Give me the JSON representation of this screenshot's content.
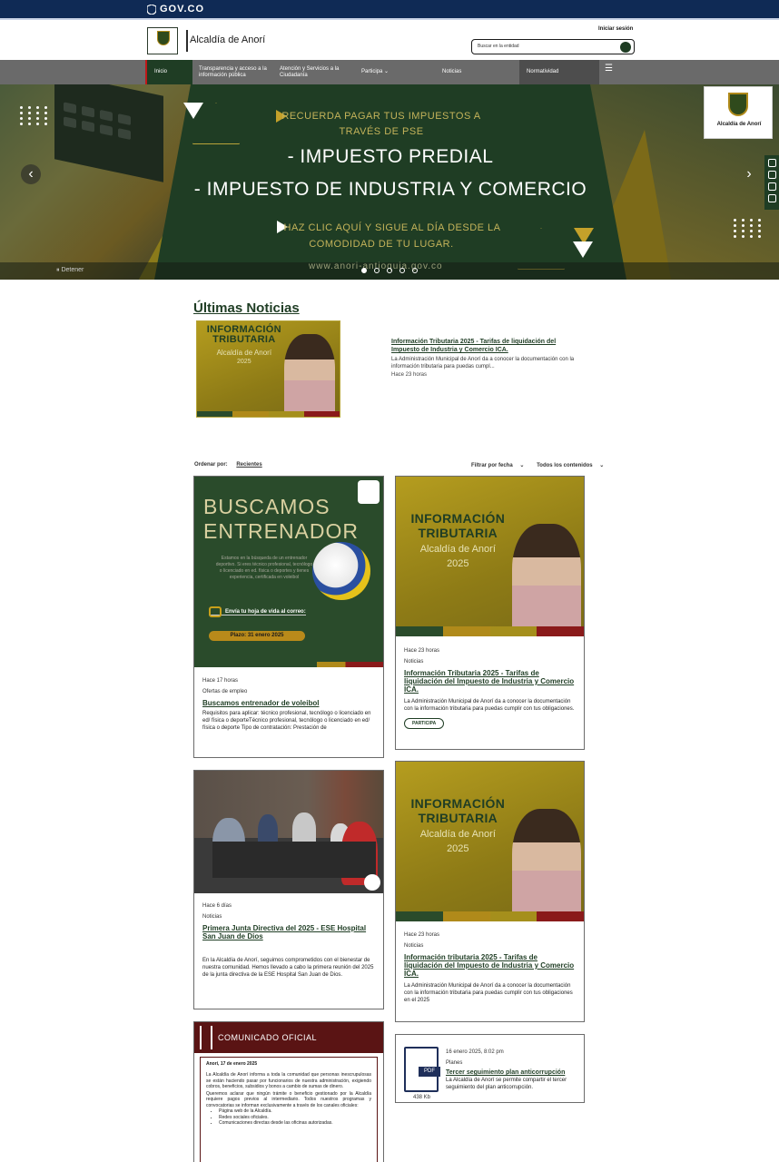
{
  "gov": {
    "label": "GOV.CO"
  },
  "header": {
    "brand": "Alcaldía de Anorí",
    "login": "Iniciar sesión",
    "search_placeholder": "Buscar en la entidad"
  },
  "nav": {
    "items": [
      {
        "label": "Inicio"
      },
      {
        "label": "Transparencia y acceso a la información pública"
      },
      {
        "label": "Atención y Servicios a la Ciudadanía"
      },
      {
        "label": "Participa"
      },
      {
        "label": "Noticias"
      },
      {
        "label": "Normatividad"
      }
    ],
    "menu_icon": "hamburger-icon"
  },
  "hero": {
    "line1": "RECUERDA PAGAR TUS IMPUESTOS A",
    "line2": "TRAVÉS DE PSE",
    "big1": "- IMPUESTO PREDIAL",
    "big2": "- IMPUESTO DE INDUSTRIA Y COMERCIO",
    "line3": "HAZ CLIC AQUÍ Y SIGUE AL DÍA DESDE LA",
    "line4": "COMODIDAD DE TU LUGAR.",
    "badge": "Alcaldía de Anorí",
    "url": "www.anori-antioquia.gov.co",
    "stop": "Detener"
  },
  "news": {
    "title": "Últimas Noticias",
    "featured": {
      "img_h1a": "INFORMACIÓN",
      "img_h1b": "TRIBUTARIA",
      "img_h2a": "Alcaldía de Anorí",
      "img_h2b": "2025",
      "title": "Información Tributaria 2025 - Tarifas de liquidación del Impuesto de Industria y Comercio ICA.",
      "desc": "La Administración Municipal de Anorí da a conocer la documentación con la información tributaria para puedas cumpl...",
      "time": "Hace 23 horas"
    }
  },
  "filters": {
    "order_label": "Ordenar por:",
    "order_value": "Recientes",
    "date": "Filtrar por fecha",
    "content": "Todos los contenidos"
  },
  "cards": {
    "coach": {
      "big1": "BUSCAMOS",
      "big2": "ENTRENADOR",
      "small": "Estamos en la búsqueda de un entrenador deportivo. Si eres técnico profesional, tecnólogo o licenciado en ed. física o deportes y tienes experiencia, certificada en voleibol",
      "email": "Envía tu hoja de vida al correo:",
      "deadline": "Plazo: 31 enero 2025",
      "time": "Hace 17 horas",
      "category": "Ofertas de empleo",
      "title": "Buscamos entrenador de voleibol",
      "desc": "Requisitos para aplicar: técnico profesional, tecnólogo o licenciado en ed/ física o deporteTécnico profesional, tecnólogo o licenciado en ed/ física o deporte Tipo de contratación: Prestación de"
    },
    "tax1": {
      "time": "Hace 23 horas",
      "category": "Noticias",
      "title": "Información Tributaria 2025 - Tarifas de liquidación del Impuesto de Industria y Comercio ICA.",
      "desc": "La Administración Municipal de Anorí da a conocer la documentación con la información tributaria para puedas cumplir con tus obligaciones.",
      "tag": "PARTICIPA"
    },
    "meeting": {
      "time": "Hace 6 días",
      "category": "Noticias",
      "title": "Primera Junta Directiva del 2025 - ESE Hospital San Juan de Dios",
      "desc": "En la Alcaldía de Anorí, seguimos comprometidos con el bienestar de nuestra comunidad. Hemos llevado a cabo la primera reunión del 2025 de la junta directiva de la ESE Hospital San Juan de Dios."
    },
    "tax2": {
      "time": "Hace 23 horas",
      "category": "Noticias",
      "title": "Información tributaria 2025 - Tarifas de liquidación del Impuesto de Industria y Comercio ICA.",
      "desc": "La Administración Municipal de Anorí da a conocer la documentación con la información tributaria para puedas cumplir con tus obligaciones en el 2025"
    },
    "comunicado": {
      "bar": "COMUNICADO OFICIAL",
      "date": "Anorí, 17 de enero 2025",
      "p1": "La Alcaldía de Anorí informa a toda la comunidad que personas inescrupulosas se están haciendo pasar por funcionarios de nuestra administración, exigiendo cobros, beneficios, subsidios y bonos a cambio de sumas de dinero.",
      "p2": "Queremos aclarar que ningún trámite o beneficio gestionado por la Alcaldía requiere pagos previos al intermediario. Todos nuestros programas y convocatorias se informan exclusivamente a través de los canales oficiales:",
      "b1": "Página web de la Alcaldía.",
      "b2": "Redes sociales oficiales.",
      "b3": "Comunicaciones directas desde las oficinas autorizadas."
    },
    "pdf": {
      "date": "16 enero 2025, 8:02 pm",
      "category": "Planes",
      "title": "Tercer seguimiento plan anticorrupción",
      "desc": "La Alcaldía de Anorí se permite compartir el tercer seguimiento del plan anticorrupción.",
      "size": "438 Kb",
      "tag": "PDF"
    }
  },
  "colors": {
    "gov_blue": "#0f2a55",
    "brand_green": "#1f3d24",
    "gold": "#a58f1c",
    "red": "#8a1a1a"
  }
}
